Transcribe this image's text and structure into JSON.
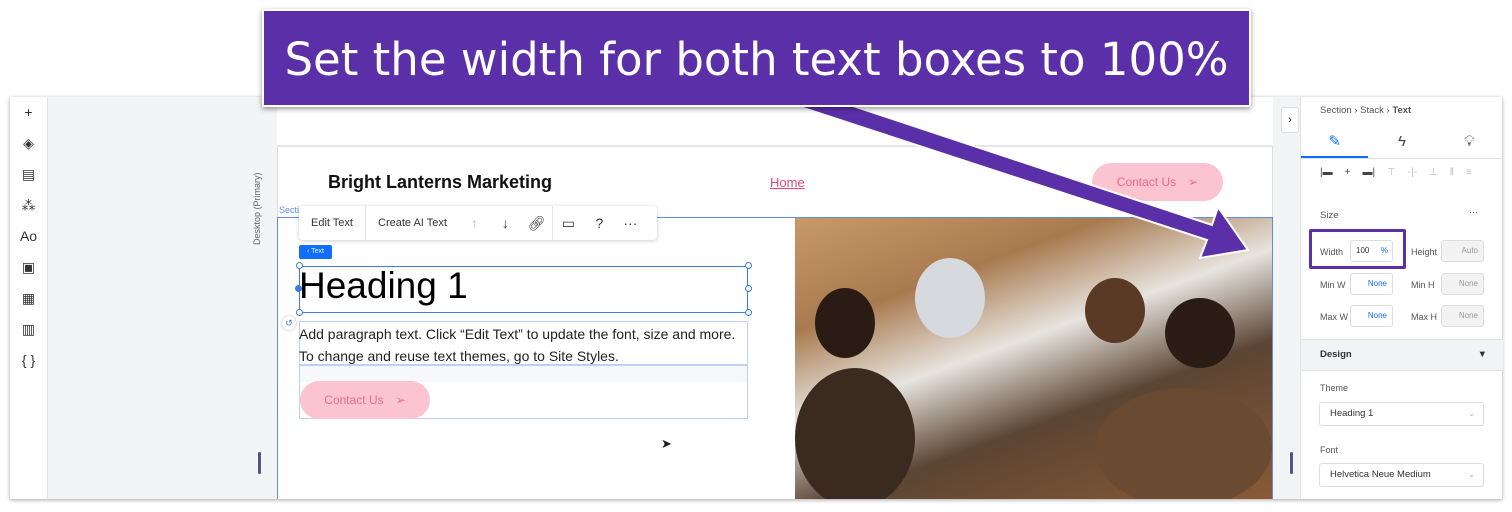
{
  "banner": {
    "text": "Set the width for both text boxes to 100%"
  },
  "left_toolbar": {
    "icons": [
      "plus-icon",
      "layers-icon",
      "page-icon",
      "components-icon",
      "text-icon",
      "image-icon",
      "apps-icon",
      "table-icon",
      "code-icon"
    ],
    "glyphs": [
      "+",
      "◈",
      "▤",
      "⁂",
      "Aᴏ",
      "▣",
      "▦",
      "▥",
      "{ }"
    ]
  },
  "canvas": {
    "viewport_label": "Desktop (Primary)",
    "section_label": "Secti",
    "site_title": "Bright Lanterns Marketing",
    "nav_home": "Home",
    "header_cta": "Contact Us"
  },
  "text_toolbar": {
    "edit_text": "Edit Text",
    "create_ai_text": "Create AI Text"
  },
  "selection_tag": "‹ Text",
  "heading": "Heading 1",
  "paragraph": "Add paragraph text. Click “Edit Text” to update the font, size and more. To change and reuse text themes, go to Site Styles.",
  "body_cta": "Contact Us",
  "panel": {
    "breadcrumb": [
      "Section",
      "Stack",
      "Text"
    ],
    "size": {
      "title": "Size",
      "more": "···",
      "width_label": "Width",
      "width_value": "100",
      "width_unit": "%",
      "height_label": "Height",
      "height_value": "Auto",
      "minw_label": "Min W",
      "minw_value": "None",
      "minh_label": "Min H",
      "minh_value": "None",
      "maxw_label": "Max W",
      "maxw_value": "None",
      "maxh_label": "Max H",
      "maxh_value": "None"
    },
    "design": {
      "title": "Design",
      "theme_label": "Theme",
      "theme_value": "Heading 1",
      "font_label": "Font",
      "font_value": "Helvetica Neue Medium"
    }
  },
  "colors": {
    "accent": "#116dff",
    "banner": "#5b2fa8",
    "cta_bg": "#fbc4d0",
    "cta_text": "#e86b8f"
  }
}
